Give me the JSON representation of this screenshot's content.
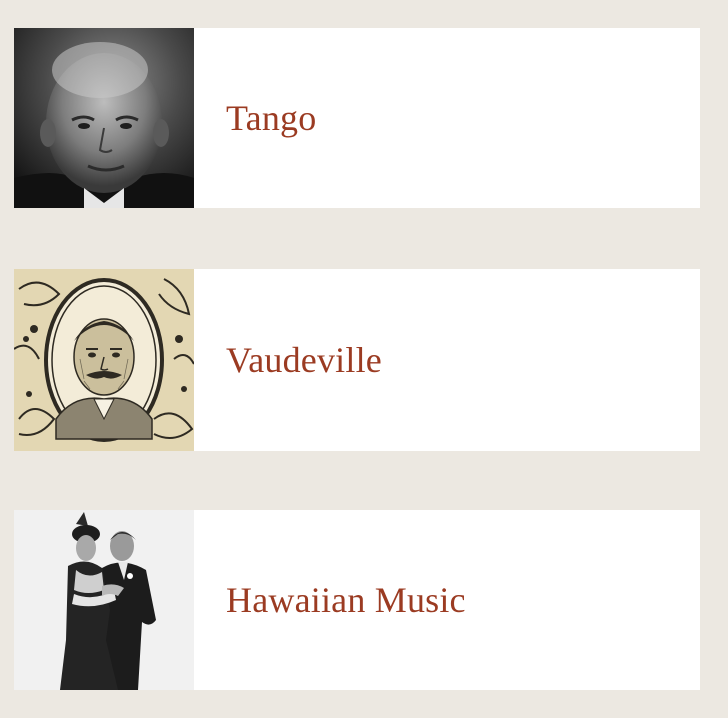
{
  "cards": [
    {
      "title": "Tango",
      "thumbnail": "portrait-bald-man-photo"
    },
    {
      "title": "Vaudeville",
      "thumbnail": "engraved-portrait-mustached-man"
    },
    {
      "title": "Hawaiian Music",
      "thumbnail": "dancing-couple-photo"
    }
  ],
  "colors": {
    "page_background": "#ece8e1",
    "card_background": "#ffffff",
    "title_text": "#9b3b22"
  }
}
